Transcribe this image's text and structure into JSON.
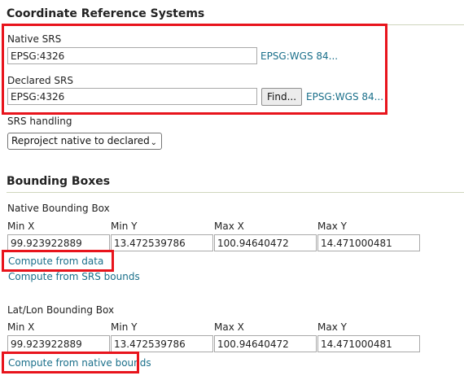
{
  "crs": {
    "title": "Coordinate Reference Systems",
    "native_label": "Native SRS",
    "native_value": "EPSG:4326",
    "native_link": "EPSG:WGS 84...",
    "declared_label": "Declared SRS",
    "declared_value": "EPSG:4326",
    "find_button": "Find...",
    "declared_link": "EPSG:WGS 84...",
    "handling_label": "SRS handling",
    "handling_value": "Reproject native to declared"
  },
  "bbox": {
    "title": "Bounding Boxes",
    "native": {
      "label": "Native Bounding Box",
      "headers": [
        "Min X",
        "Min Y",
        "Max X",
        "Max Y"
      ],
      "values": [
        "99.923922889",
        "13.472539786",
        "100.94640472",
        "14.471000481"
      ],
      "compute_data_link": "Compute from data",
      "compute_srs_link": "Compute from SRS bounds"
    },
    "latlon": {
      "label": "Lat/Lon Bounding Box",
      "headers": [
        "Min X",
        "Min Y",
        "Max X",
        "Max Y"
      ],
      "values": [
        "99.923922889",
        "13.472539786",
        "100.94640472",
        "14.471000481"
      ],
      "compute_native_link": "Compute from native bounds"
    }
  },
  "colors": {
    "link": "#1a6f8a",
    "highlight": "#e8141c",
    "rule": "#cfd6bd"
  }
}
